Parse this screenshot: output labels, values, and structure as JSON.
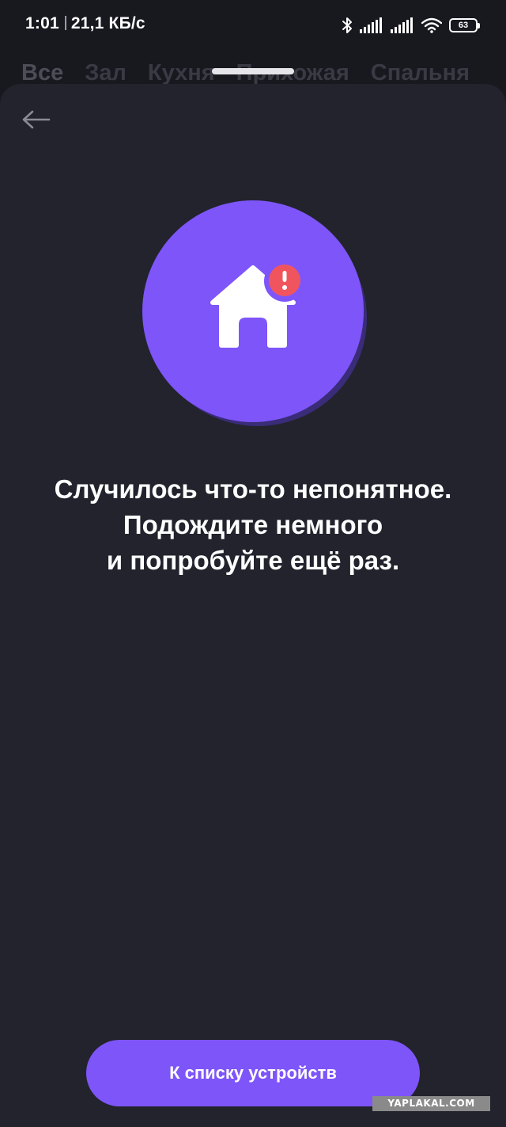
{
  "status_bar": {
    "time": "1:01",
    "network_speed": "21,1 КБ/с",
    "battery_level": "63",
    "icons": [
      "bluetooth-icon",
      "signal-icon",
      "signal-icon",
      "wifi-icon",
      "battery-icon"
    ]
  },
  "background_tabs": [
    "Все",
    "Зал",
    "Кухня",
    "Прихожая",
    "Спальня"
  ],
  "sheet": {
    "back_icon": "arrow-left-icon",
    "illustration_icon": "home-error-icon",
    "message_lines": [
      "Случилось что-то непонятное.",
      "Подождите немного",
      "и попробуйте ещё раз."
    ],
    "primary_button_label": "К списку устройств"
  },
  "watermark": "YAPLAKAL.COM",
  "colors": {
    "accent": "#7e55f9",
    "alert_badge": "#f0555e",
    "sheet_background": "#22232c",
    "screen_background": "#18181f"
  }
}
